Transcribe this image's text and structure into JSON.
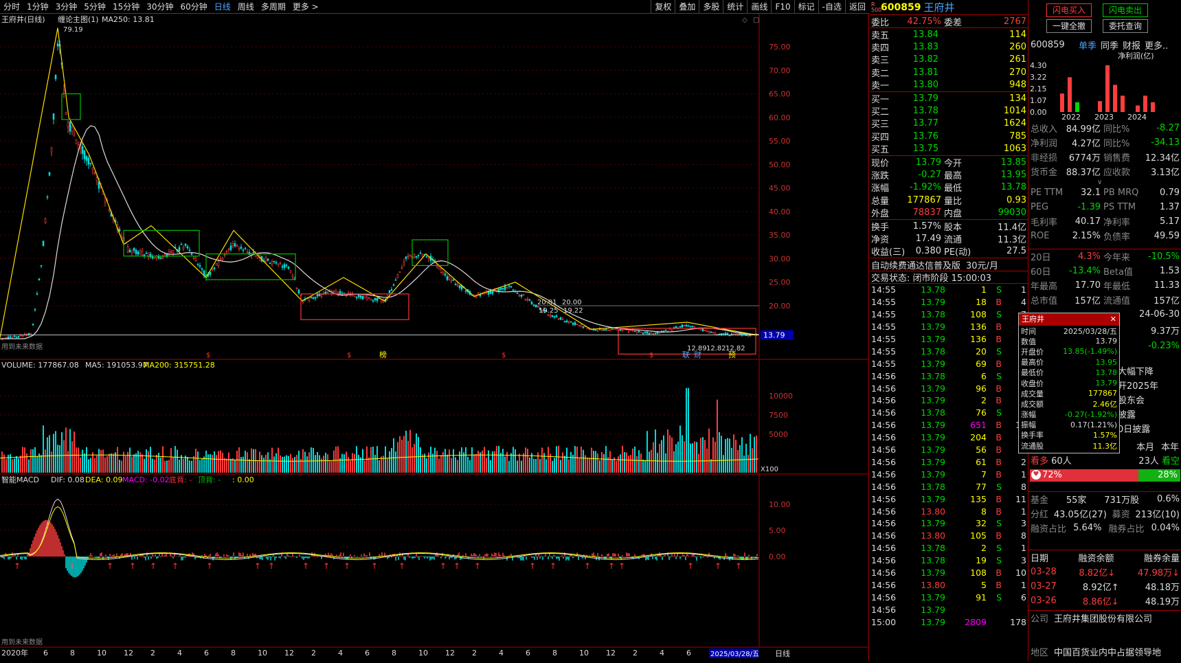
{
  "toolbar": {
    "periods": [
      "分时",
      "1分钟",
      "3分钟",
      "5分钟",
      "15分钟",
      "30分钟",
      "60分钟",
      "日线",
      "周线",
      "多周期",
      "更多 >"
    ],
    "active": "日线",
    "tools": [
      "复权",
      "叠加",
      "多股",
      "统计",
      "画线",
      "F10",
      "标记",
      "-自选",
      "返回"
    ]
  },
  "chart": {
    "title": "王府井(日线)",
    "indicator": "缠论主图(1)",
    "ma250": "MA250: 13.81",
    "peak_label": "79.19",
    "price_ticks": [
      "75.00",
      "70.00",
      "65.00",
      "60.00",
      "55.00",
      "50.00",
      "45.00",
      "40.00",
      "35.00",
      "30.00",
      "25.00",
      "20.00"
    ],
    "current_price_tag": "13.79",
    "note_main": "用到未来数据",
    "annot1": "20.01",
    "annot2": "20.00",
    "annot3": "19.25",
    "annot4": "19.22",
    "annot5": "12.89",
    "annot6": "12.82",
    "annot7": "12.82",
    "tag_bang": "榜",
    "tag_cai": "财",
    "tag_yu": "预",
    "tag_lian": "联",
    "volume_title": "VOLUME: 177867.08",
    "vol_ma5": "MA5: 191053.97",
    "vol_ma200": "MA200: 315751.28",
    "vol_ticks": [
      "10000",
      "7500",
      "5000"
    ],
    "vol_unit": "X100",
    "macd_title": "智能MACD",
    "dif": "DIF: 0.08",
    "dea": "DEA: 0.09",
    "macd": "MACD: -0.02",
    "bottom_div": "底背: -",
    "top_div": "顶背: -",
    "zero_val": ": 0.00",
    "macd_ticks": [
      "10.00",
      "5.00",
      "0.00"
    ],
    "note_macd": "用到未来数据",
    "x_labels": [
      "2020年",
      "6",
      "8",
      "10",
      "12",
      "2",
      "4",
      "6",
      "8",
      "10",
      "12",
      "2",
      "4",
      "6",
      "8",
      "10",
      "12",
      "2",
      "4",
      "6",
      "8",
      "10",
      "12",
      "2",
      "4",
      "6",
      "8",
      "10"
    ],
    "date_tag": "2025/03/28/五",
    "axis_mode": "日线"
  },
  "quote": {
    "code": "600859",
    "name": "王府井",
    "r_label": "R",
    "r_num": "500",
    "weibi_label": "委比",
    "weibi": "42.75%",
    "weicha_label": "委差",
    "weicha": "2767",
    "asks": [
      {
        "l": "卖五",
        "p": "13.84",
        "v": "114"
      },
      {
        "l": "卖四",
        "p": "13.83",
        "v": "260"
      },
      {
        "l": "卖三",
        "p": "13.82",
        "v": "261"
      },
      {
        "l": "卖二",
        "p": "13.81",
        "v": "270"
      },
      {
        "l": "卖一",
        "p": "13.80",
        "v": "948"
      }
    ],
    "bids": [
      {
        "l": "买一",
        "p": "13.79",
        "v": "134"
      },
      {
        "l": "买二",
        "p": "13.78",
        "v": "1014"
      },
      {
        "l": "买三",
        "p": "13.77",
        "v": "1624"
      },
      {
        "l": "买四",
        "p": "13.76",
        "v": "785"
      },
      {
        "l": "买五",
        "p": "13.75",
        "v": "1063"
      }
    ],
    "stats": [
      {
        "l1": "现价",
        "v1": "13.79",
        "c1": "green",
        "l2": "今开",
        "v2": "13.85",
        "c2": "green"
      },
      {
        "l1": "涨跌",
        "v1": "-0.27",
        "c1": "green",
        "l2": "最高",
        "v2": "13.95",
        "c2": "green"
      },
      {
        "l1": "涨幅",
        "v1": "-1.92%",
        "c1": "green",
        "l2": "最低",
        "v2": "13.78",
        "c2": "green"
      },
      {
        "l1": "总量",
        "v1": "177867",
        "c1": "yel",
        "l2": "量比",
        "v2": "0.93",
        "c2": "yel"
      },
      {
        "l1": "外盘",
        "v1": "78837",
        "c1": "red",
        "l2": "内盘",
        "v2": "99030",
        "c2": "green"
      }
    ],
    "stats2": [
      {
        "l1": "换手",
        "v1": "1.57%",
        "l2": "股本",
        "v2": "11.4亿"
      },
      {
        "l1": "净资",
        "v1": "17.49",
        "l2": "流通",
        "v2": "11.3亿"
      },
      {
        "l1": "收益(三)",
        "v1": "0.380",
        "l2": "PE(动)",
        "v2": "27.5"
      }
    ],
    "promo": "自动续费通达信普及版",
    "promo_price": "30元/月",
    "trade_state": "交易状态: 闭市阶段 15:00:03",
    "ticks": [
      [
        "14:55",
        "13.78",
        "1",
        "S",
        "1"
      ],
      [
        "14:55",
        "13.79",
        "18",
        "B",
        "4"
      ],
      [
        "14:55",
        "13.78",
        "108",
        "S",
        "7"
      ],
      [
        "14:55",
        "13.79",
        "136",
        "B",
        "7"
      ],
      [
        "14:55",
        "13.79",
        "136",
        "B",
        "5"
      ],
      [
        "14:55",
        "13.78",
        "20",
        "S",
        "3"
      ],
      [
        "14:55",
        "13.79",
        "69",
        "B",
        "4"
      ],
      [
        "14:56",
        "13.78",
        "6",
        "S",
        "1"
      ],
      [
        "14:56",
        "13.79",
        "96",
        "B",
        "3"
      ],
      [
        "14:56",
        "13.79",
        "2",
        "B",
        "1"
      ],
      [
        "14:56",
        "13.78",
        "76",
        "S",
        "5"
      ],
      [
        "14:56",
        "13.79",
        "651",
        "B",
        "18"
      ],
      [
        "14:56",
        "13.79",
        "204",
        "B",
        "5"
      ],
      [
        "14:56",
        "13.79",
        "56",
        "B",
        "6"
      ],
      [
        "14:56",
        "13.79",
        "61",
        "B",
        "2"
      ],
      [
        "14:56",
        "13.79",
        "7",
        "B",
        "1"
      ],
      [
        "14:56",
        "13.78",
        "77",
        "S",
        "8"
      ],
      [
        "14:56",
        "13.79",
        "135",
        "B",
        "11"
      ],
      [
        "14:56",
        "13.80",
        "8",
        "B",
        "1"
      ],
      [
        "14:56",
        "13.79",
        "32",
        "S",
        "3"
      ],
      [
        "14:56",
        "13.80",
        "105",
        "B",
        "8"
      ],
      [
        "14:56",
        "13.78",
        "2",
        "S",
        "1"
      ],
      [
        "14:56",
        "13.78",
        "19",
        "S",
        "3"
      ],
      [
        "14:56",
        "13.79",
        "108",
        "B",
        "10"
      ],
      [
        "14:56",
        "13.80",
        "5",
        "B",
        "1"
      ],
      [
        "14:56",
        "13.79",
        "91",
        "S",
        "6"
      ],
      [
        "14:56",
        "13.79",
        "",
        "",
        ""
      ],
      [
        "15:00",
        "13.79",
        "2809",
        "",
        "178"
      ]
    ]
  },
  "popup": {
    "title": "王府井",
    "rows": [
      {
        "l": "时间",
        "v": "2025/03/28/五",
        "c": "white"
      },
      {
        "l": "数值",
        "v": "13.79",
        "c": "white"
      },
      {
        "l": "开盘价",
        "v": "13.85(-1.49%)",
        "c": "green"
      },
      {
        "l": "最高价",
        "v": "13.95",
        "c": "green"
      },
      {
        "l": "最低价",
        "v": "13.78",
        "c": "green"
      },
      {
        "l": "收盘价",
        "v": "13.79",
        "c": "green"
      },
      {
        "l": "成交量",
        "v": "177867",
        "c": "yel"
      },
      {
        "l": "成交额",
        "v": "2.46亿",
        "c": "yel"
      },
      {
        "l": "涨幅",
        "v": "-0.27(-1.92%)",
        "c": "green"
      },
      {
        "l": "振幅",
        "v": "0.17(1.21%)",
        "c": "white"
      },
      {
        "l": "换手率",
        "v": "1.57%",
        "c": "yel"
      },
      {
        "l": "流通股",
        "v": "11.3亿",
        "c": "yel"
      }
    ]
  },
  "f10": {
    "btn_buy": "闪电买入",
    "btn_sell": "闪电卖出",
    "btn_cancel": "一键全撤",
    "btn_query": "委托查询",
    "code": "600859",
    "tabs": [
      "单季",
      "同季",
      "财报",
      "更多.."
    ],
    "profit_label": "净利润(亿)",
    "bar_ticks": [
      "4.30",
      "3.22",
      "2.15",
      "1.07",
      "0.00"
    ],
    "years": [
      "2022",
      "2023",
      "2024"
    ],
    "bars": [
      1.7,
      3.2,
      0.9,
      0,
      0,
      1.0,
      4.3,
      2.5,
      1.5,
      0,
      0.6,
      1.5,
      0.9
    ],
    "rows1": [
      {
        "a": "总收入",
        "b": "84.99亿",
        "c": "同比%",
        "d": "-8.27"
      },
      {
        "a": "净利润",
        "b": "4.27亿",
        "c": "同比%",
        "d": "-34.13"
      },
      {
        "a": "非经损",
        "b": "6774万",
        "c": "销售费",
        "d": "12.34亿"
      },
      {
        "a": "货币金",
        "b": "88.37亿",
        "c": "应收款",
        "d": "3.13亿"
      }
    ],
    "rows2": [
      {
        "a": "PE TTM",
        "b": "32.1",
        "c": "PB MRQ",
        "d": "0.79"
      },
      {
        "a": "PEG",
        "b": "-1.39",
        "c": "PS TTM",
        "d": "1.37"
      },
      {
        "a": "毛利率",
        "b": "40.17",
        "c": "净利率",
        "d": "5.17"
      },
      {
        "a": "ROE",
        "b": "2.15%",
        "c": "负债率",
        "d": "49.59"
      }
    ],
    "rows3": [
      {
        "a": "20日",
        "b": "4.3%",
        "c": "今年来",
        "d": "-10.5%"
      },
      {
        "a": "60日",
        "b": "-13.4%",
        "c": "Beta值",
        "d": "1.53"
      },
      {
        "a": "年最高",
        "b": "17.70",
        "c": "年最低",
        "d": "11.33"
      },
      {
        "a": "总市值",
        "b": "157亿",
        "c": "流通值",
        "d": "157亿"
      }
    ],
    "side1": "24-06-30",
    "side2": "9.37万",
    "side3": "-0.23%",
    "news": [
      "大幅下降",
      "开2025年",
      "股东会",
      "披露",
      "0日披露"
    ],
    "month_tabs": [
      "本月",
      "本年"
    ],
    "bull_label": "看多",
    "bull_count": "60人",
    "bear_count": "23人",
    "bear_label": "看空",
    "bull_pct": "72%",
    "bear_pct": "28%",
    "fund_label": "基金",
    "fund_count": "55家",
    "fund_shares": "731万股",
    "fund_pct": "0.6%",
    "div_label": "分红",
    "div_val": "43.05亿(27)",
    "raise_label": "募资",
    "raise_val": "213亿(10)",
    "margin_label": "融资占比",
    "margin_val": "5.64%",
    "short_label": "融券占比",
    "short_val": "0.04%",
    "mt_head": [
      "日期",
      "融资余额",
      "融券余量"
    ],
    "mt_rows": [
      [
        "03-28",
        "8.82亿↓",
        "47.98万↓"
      ],
      [
        "03-27",
        "8.92亿↑",
        "48.18万"
      ],
      [
        "03-26",
        "8.86亿↓",
        "48.19万"
      ]
    ],
    "company_label": "公司",
    "company": "王府井集团股份有限公司",
    "region_label": "地区",
    "region": "中国百货业内中占据领导地"
  }
}
